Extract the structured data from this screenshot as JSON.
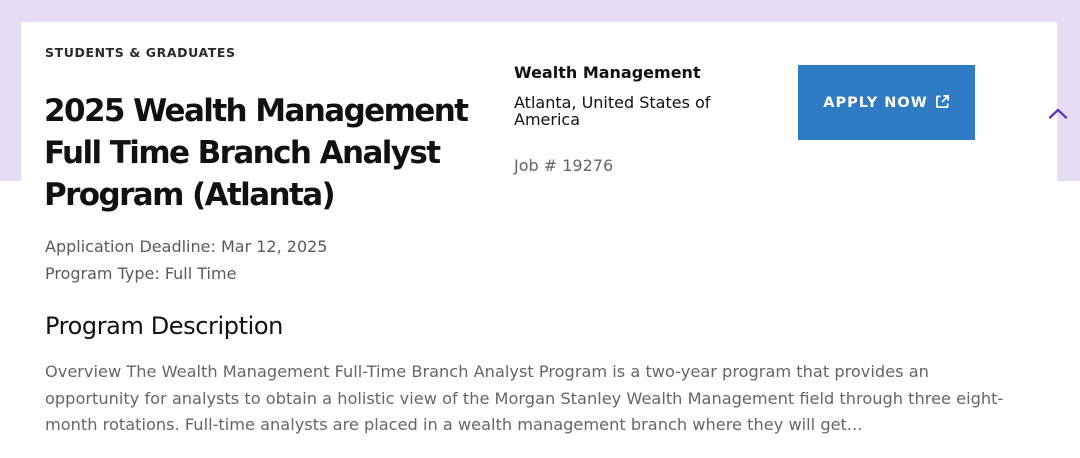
{
  "job": {
    "category": "STUDENTS & GRADUATES",
    "title": "2025 Wealth Management Full Time Branch Analyst Program (Atlanta)",
    "deadline": "Application Deadline: Mar 12, 2025",
    "program_type": "Program Type: Full Time",
    "division": "Wealth Management",
    "location": "Atlanta, United States of America",
    "job_number": "Job # 19276"
  },
  "apply_button": {
    "label": "APPLY NOW",
    "icon": "external-link-icon"
  },
  "collapse_toggle": {
    "icon": "chevron-up-icon"
  },
  "description": {
    "heading": "Program Description",
    "text": "Overview The Wealth Management Full-Time Branch Analyst Program is a two-year program that provides an opportunity for analysts to obtain a holistic view of the Morgan Stanley Wealth Management field through three eight-month rotations. Full-time analysts are placed in a wealth management branch where they will get..."
  },
  "colors": {
    "band": "#e6dcf4",
    "apply_button": "#2f7bc4",
    "chevron": "#6a2fc0"
  }
}
